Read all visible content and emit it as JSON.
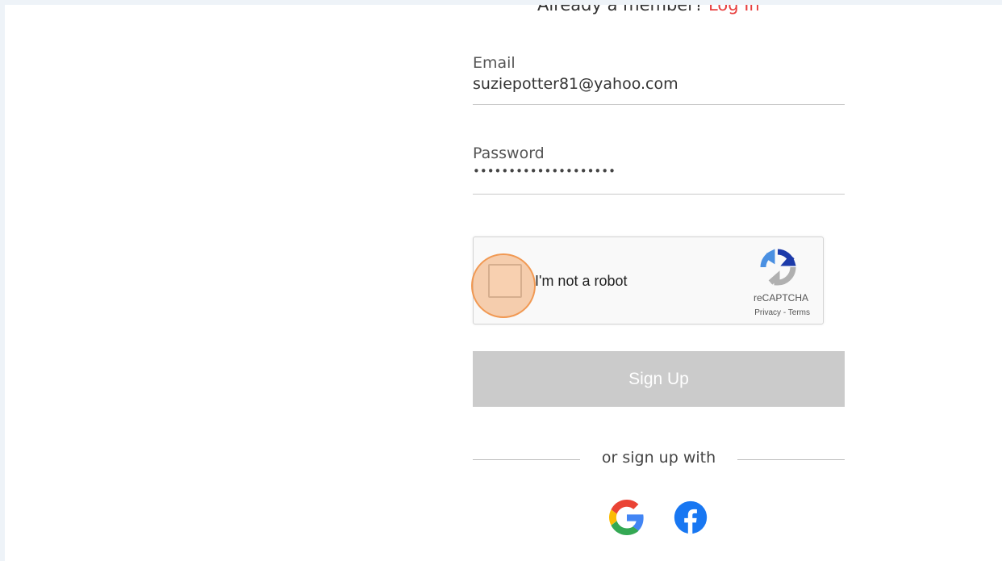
{
  "header": {
    "member_prompt": "Already a member?",
    "login_link": "Log In"
  },
  "form": {
    "email_label": "Email",
    "email_value": "suziepotter81@yahoo.com",
    "password_label": "Password",
    "password_masked": "••••••••••••••••••••"
  },
  "captcha": {
    "label": "I'm not a robot",
    "brand": "reCAPTCHA",
    "privacy_link": "Privacy",
    "separator": " - ",
    "terms_link": "Terms"
  },
  "signup_button": "Sign Up",
  "divider_text": "or sign up with",
  "social": [
    {
      "name": "google-icon"
    },
    {
      "name": "facebook-icon"
    }
  ],
  "colors": {
    "accent": "#e8403f",
    "button_disabled": "#cbcbcb",
    "facebook_blue": "#1877f2"
  }
}
